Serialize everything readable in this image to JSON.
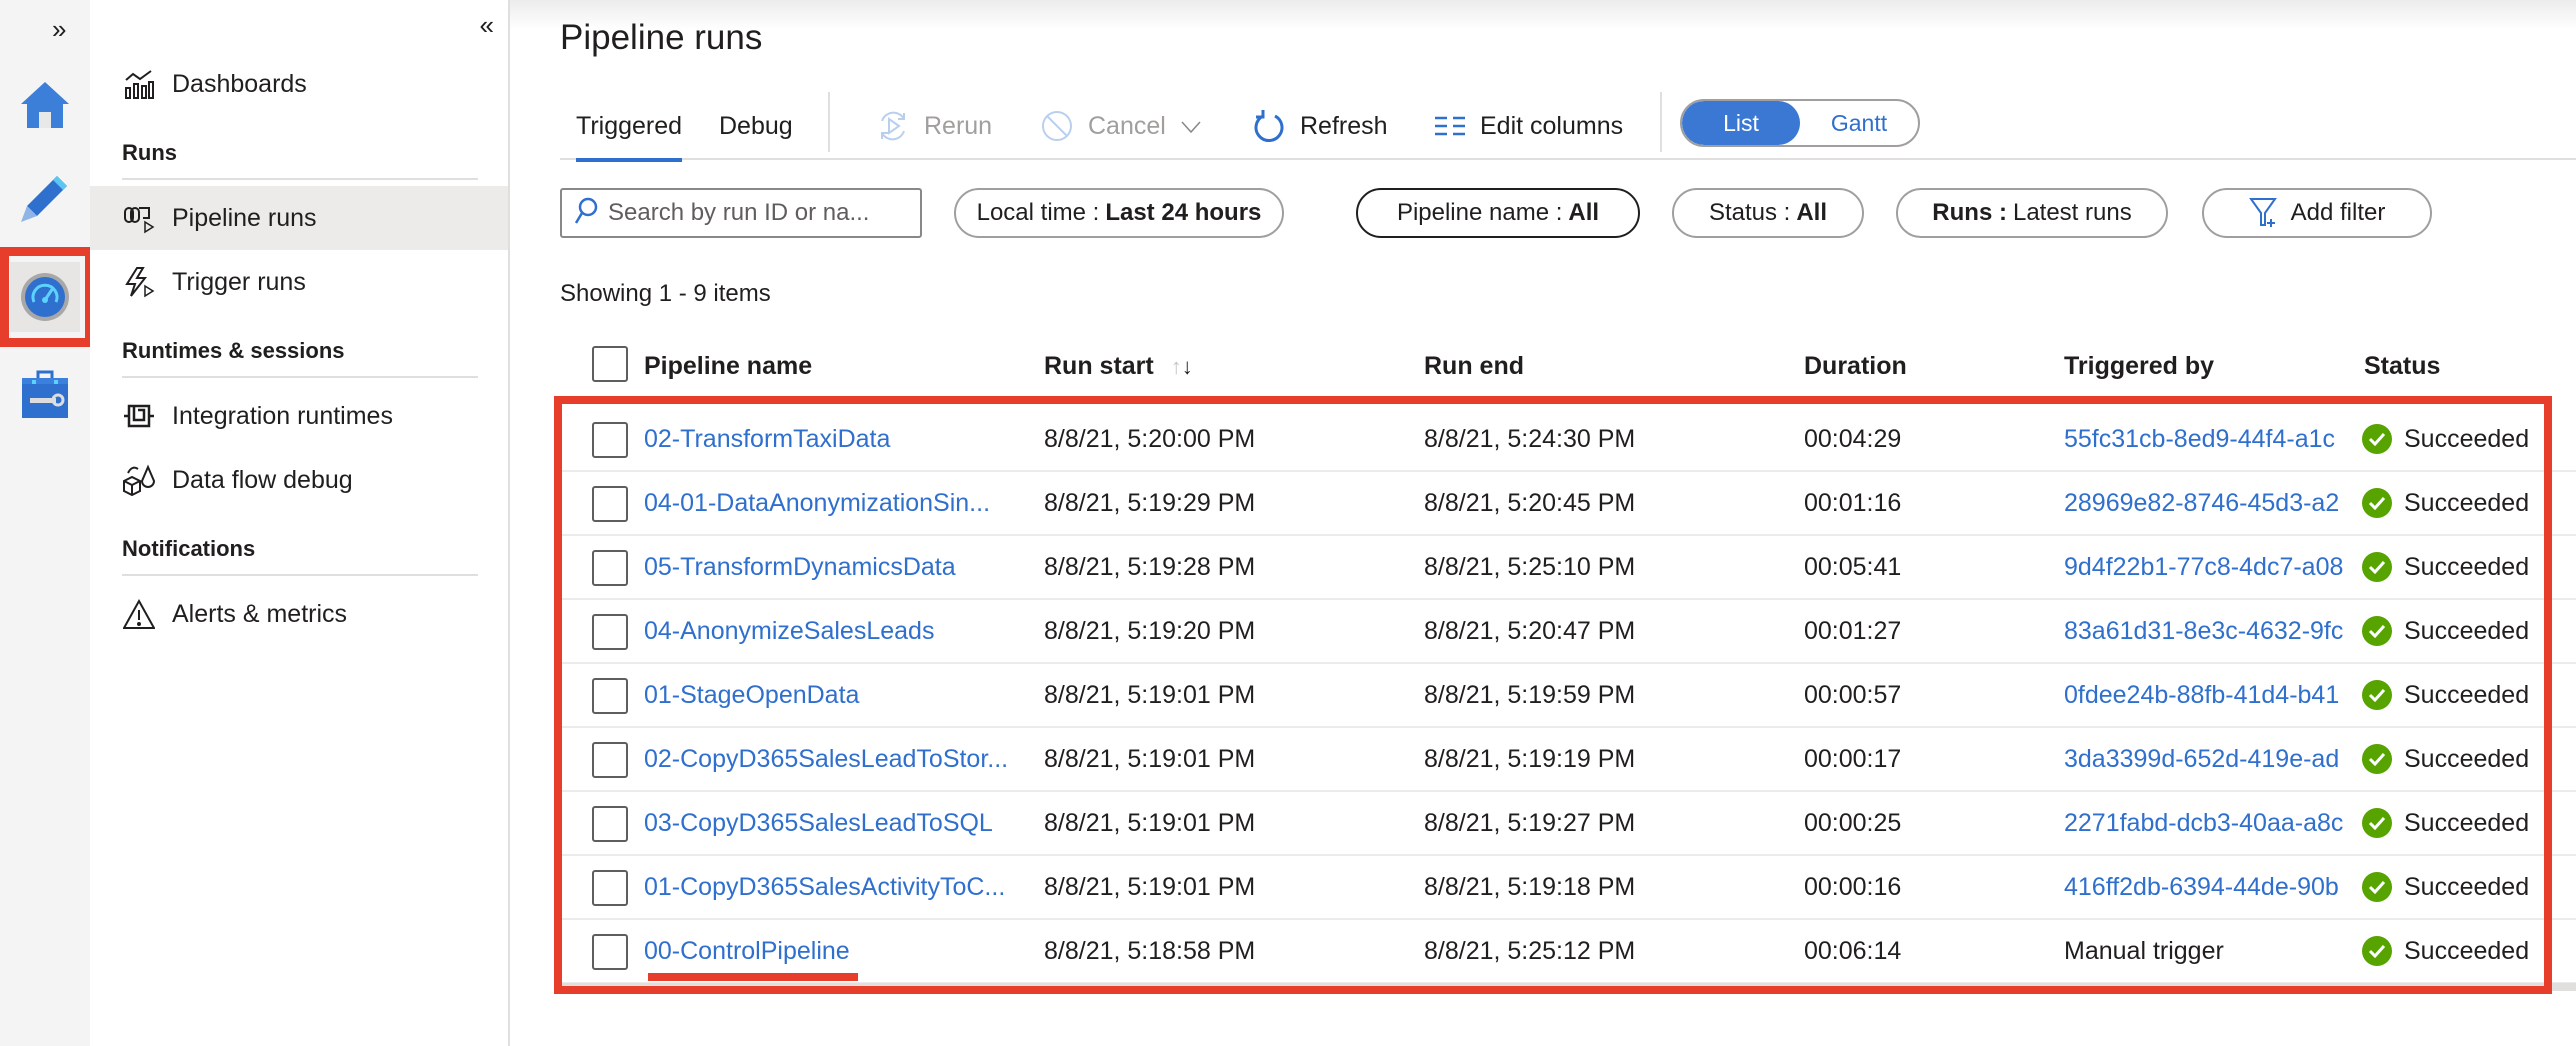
{
  "rail": {
    "expand_label": "»",
    "items": [
      {
        "name": "home-icon",
        "label": "Home"
      },
      {
        "name": "author-pencil-icon",
        "label": "Author"
      },
      {
        "name": "monitor-gauge-icon",
        "label": "Monitor",
        "active": true
      },
      {
        "name": "manage-toolbox-icon",
        "label": "Manage"
      }
    ]
  },
  "nav": {
    "collapse_label": "«",
    "dashboards": "Dashboards",
    "sections": {
      "runs": "Runs",
      "runtimes": "Runtimes & sessions",
      "notifications": "Notifications"
    },
    "items": {
      "pipeline_runs": "Pipeline runs",
      "trigger_runs": "Trigger runs",
      "integration_runtimes": "Integration runtimes",
      "data_flow_debug": "Data flow debug",
      "alerts_metrics": "Alerts & metrics"
    }
  },
  "page": {
    "title": "Pipeline runs",
    "tabs": [
      "Triggered",
      "Debug"
    ],
    "active_tab": "Triggered",
    "toolbar": {
      "rerun": "Rerun",
      "cancel": "Cancel",
      "refresh": "Refresh",
      "edit_columns": "Edit columns"
    },
    "view_toggle": {
      "list": "List",
      "gantt": "Gantt",
      "selected": "List"
    },
    "search": {
      "placeholder": "Search by run ID or na...",
      "value": ""
    },
    "filters": {
      "local_time": {
        "label": "Local time :",
        "value": "Last 24 hours"
      },
      "pipeline_name": {
        "label": "Pipeline name :",
        "value": "All"
      },
      "status": {
        "label": "Status :",
        "value": "All"
      },
      "runs": {
        "label": "Runs :",
        "value": "Latest runs"
      },
      "add_filter": "Add filter"
    },
    "showing": "Showing 1 - 9 items"
  },
  "table": {
    "columns": {
      "name": "Pipeline name",
      "run_start": "Run start",
      "run_end": "Run end",
      "duration": "Duration",
      "triggered_by": "Triggered by",
      "status": "Status"
    },
    "rows": [
      {
        "name": "02-TransformTaxiData",
        "run_start": "8/8/21, 5:20:00 PM",
        "run_end": "8/8/21, 5:24:30 PM",
        "duration": "00:04:29",
        "triggered_by": "55fc31cb-8ed9-44f4-a1c",
        "triggered_is_link": true,
        "status": "Succeeded"
      },
      {
        "name": "04-01-DataAnonymizationSin...",
        "run_start": "8/8/21, 5:19:29 PM",
        "run_end": "8/8/21, 5:20:45 PM",
        "duration": "00:01:16",
        "triggered_by": "28969e82-8746-45d3-a2",
        "triggered_is_link": true,
        "status": "Succeeded"
      },
      {
        "name": "05-TransformDynamicsData",
        "run_start": "8/8/21, 5:19:28 PM",
        "run_end": "8/8/21, 5:25:10 PM",
        "duration": "00:05:41",
        "triggered_by": "9d4f22b1-77c8-4dc7-a08",
        "triggered_is_link": true,
        "status": "Succeeded"
      },
      {
        "name": "04-AnonymizeSalesLeads",
        "run_start": "8/8/21, 5:19:20 PM",
        "run_end": "8/8/21, 5:20:47 PM",
        "duration": "00:01:27",
        "triggered_by": "83a61d31-8e3c-4632-9fc",
        "triggered_is_link": true,
        "status": "Succeeded"
      },
      {
        "name": "01-StageOpenData",
        "run_start": "8/8/21, 5:19:01 PM",
        "run_end": "8/8/21, 5:19:59 PM",
        "duration": "00:00:57",
        "triggered_by": "0fdee24b-88fb-41d4-b41",
        "triggered_is_link": true,
        "status": "Succeeded"
      },
      {
        "name": "02-CopyD365SalesLeadToStor...",
        "run_start": "8/8/21, 5:19:01 PM",
        "run_end": "8/8/21, 5:19:19 PM",
        "duration": "00:00:17",
        "triggered_by": "3da3399d-652d-419e-ad",
        "triggered_is_link": true,
        "status": "Succeeded"
      },
      {
        "name": "03-CopyD365SalesLeadToSQL",
        "run_start": "8/8/21, 5:19:01 PM",
        "run_end": "8/8/21, 5:19:27 PM",
        "duration": "00:00:25",
        "triggered_by": "2271fabd-dcb3-40aa-a8c",
        "triggered_is_link": true,
        "status": "Succeeded"
      },
      {
        "name": "01-CopyD365SalesActivityToC...",
        "run_start": "8/8/21, 5:19:01 PM",
        "run_end": "8/8/21, 5:19:18 PM",
        "duration": "00:00:16",
        "triggered_by": "416ff2db-6394-44de-90b",
        "triggered_is_link": true,
        "status": "Succeeded"
      },
      {
        "name": "00-ControlPipeline",
        "run_start": "8/8/21, 5:18:58 PM",
        "run_end": "8/8/21, 5:25:12 PM",
        "duration": "00:06:14",
        "triggered_by": "Manual trigger",
        "triggered_is_link": false,
        "status": "Succeeded"
      }
    ]
  },
  "colors": {
    "accent": "#2f6fcd",
    "success": "#57a300",
    "annotation": "#e63e2a"
  }
}
